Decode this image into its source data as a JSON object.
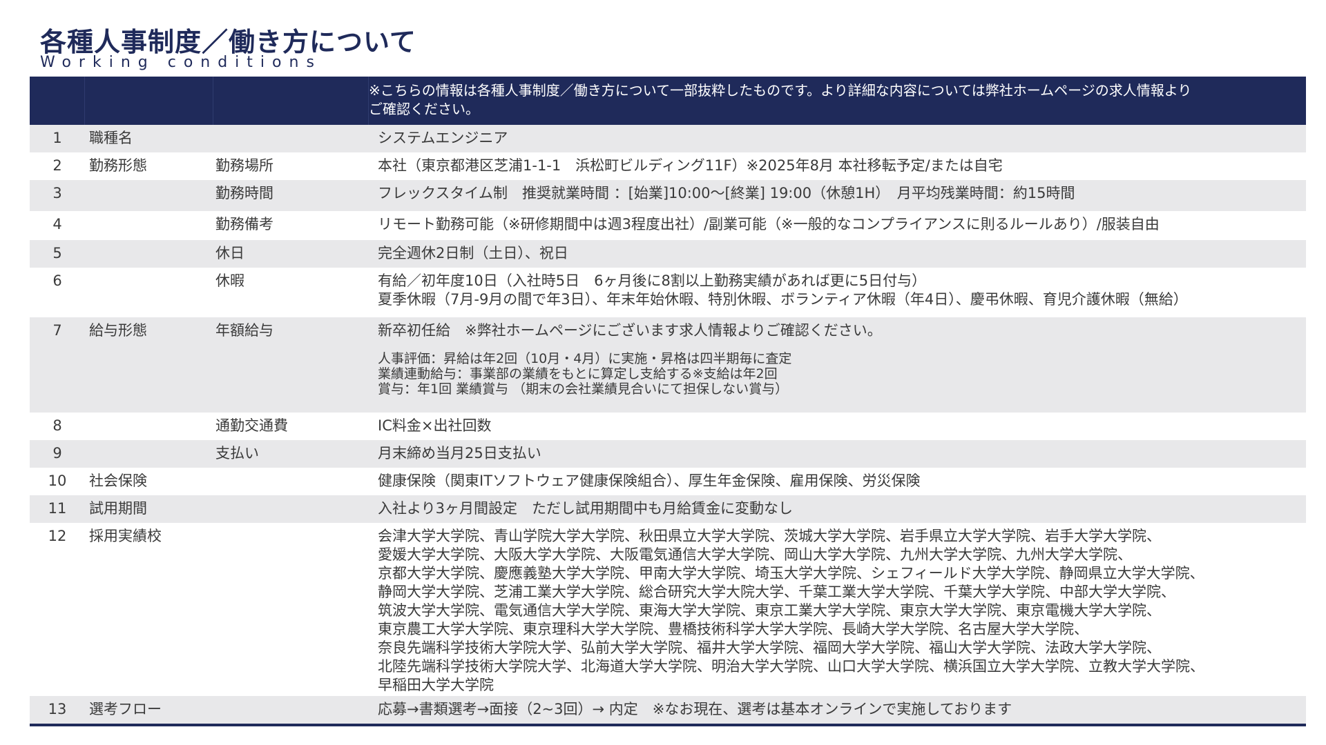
{
  "header": {
    "title": "各種人事制度／働き方について",
    "subtitle": "Working conditions"
  },
  "table": {
    "note_line1": "※こちらの情報は各種人事制度／働き方について一部抜粋したものです。より詳細な内容については弊社ホームページの求人情報より",
    "note_line2": "ご確認ください。",
    "rows": [
      {
        "no": "1",
        "category": "職種名",
        "item": "",
        "lines": [
          "システムエンジニア"
        ]
      },
      {
        "no": "2",
        "category": "勤務形態",
        "item": "勤務場所",
        "lines": [
          "本社（東京都港区芝浦1-1-1　浜松町ビルディング11F）※2025年8月 本社移転予定/または自宅"
        ]
      },
      {
        "no": "3",
        "category": "",
        "item": "勤務時間",
        "lines": [
          "フレックスタイム制　推奨就業時間 ：[始業]10:00～[終業] 19:00（休憩1H）　月平均残業時間：約15時間"
        ]
      },
      {
        "no": "4",
        "category": "",
        "item": "勤務備考",
        "lines": [
          "リモート勤務可能（※研修期間中は週3程度出社）/副業可能（※一般的なコンプライアンスに則るルールあり）/服装自由"
        ]
      },
      {
        "no": "5",
        "category": "",
        "item": "休日",
        "lines": [
          "完全週休2日制（土日）、祝日"
        ]
      },
      {
        "no": "6",
        "category": "",
        "item": "休暇",
        "lines": [
          "有給／初年度10日（入社時5日　6ヶ月後に8割以上勤務実績があれば更に5日付与）",
          "夏季休暇（7月-9月の間で年3日）、年末年始休暇、特別休暇、ボランティア休暇（年4日）、慶弔休暇、育児介護休暇（無給）"
        ]
      },
      {
        "no": "7",
        "category": "給与形態",
        "item": "年額給与",
        "lines": [
          "新卒初任給　※弊社ホームページにございます求人情報よりご確認ください。"
        ],
        "sublines": [
          "人事評価：昇給は年2回（10月・4月）に実施・昇格は四半期毎に査定",
          "業績連動給与：事業部の業績をもとに算定し支給する※支給は年2回",
          "賞与：年1回 業績賞与 （期末の会社業績見合いにて担保しない賞与）"
        ]
      },
      {
        "no": "8",
        "category": "",
        "item": "通勤交通費",
        "lines": [
          "IC料金×出社回数"
        ]
      },
      {
        "no": "9",
        "category": "",
        "item": "支払い",
        "lines": [
          "月末締め当月25日支払い"
        ]
      },
      {
        "no": "10",
        "category": "社会保険",
        "item": "",
        "lines": [
          "健康保険（関東ITソフトウェア健康保険組合）、厚生年金保険、雇用保険、労災保険"
        ]
      },
      {
        "no": "11",
        "category": "試用期間",
        "item": "",
        "lines": [
          "入社より3ヶ月間設定　ただし試用期間中も月給賃金に変動なし"
        ]
      },
      {
        "no": "12",
        "category": "採用実績校",
        "item": "",
        "lines": [
          "会津大学大学院、青山学院大学大学院、秋田県立大学大学院、茨城大学大学院、岩手県立大学大学院、岩手大学大学院、",
          "愛媛大学大学院、大阪大学大学院、大阪電気通信大学大学院、岡山大学大学院、九州大学大学院、九州大学大学院、",
          "京都大学大学院、慶應義塾大学大学院、甲南大学大学院、埼玉大学大学院、シェフィールド大学大学院、静岡県立大学大学院、",
          "静岡大学大学院、芝浦工業大学大学院、総合研究大学大院大学、千葉工業大学大学院、千葉大学大学院、中部大学大学院、",
          "筑波大学大学院、電気通信大学大学院、東海大学大学院、東京工業大学大学院、東京大学大学院、東京電機大学大学院、",
          "東京農工大学大学院、東京理科大学大学院、豊橋技術科学大学大学院、長崎大学大学院、名古屋大学大学院、",
          "奈良先端科学技術大学院大学、弘前大学大学院、福井大学大学院、福岡大学大学院、福山大学大学院、法政大学大学院、",
          "北陸先端科学技術大学院大学、北海道大学大学院、明治大学大学院、山口大学大学院、横浜国立大学大学院、立教大学大学院、",
          "早稲田大学大学院"
        ]
      },
      {
        "no": "13",
        "category": "選考フロー",
        "item": "",
        "lines": [
          "応募→書類選考→面接（2~3回）→ 内定　※なお現在、選考は基本オンラインで実施しております"
        ]
      }
    ]
  }
}
